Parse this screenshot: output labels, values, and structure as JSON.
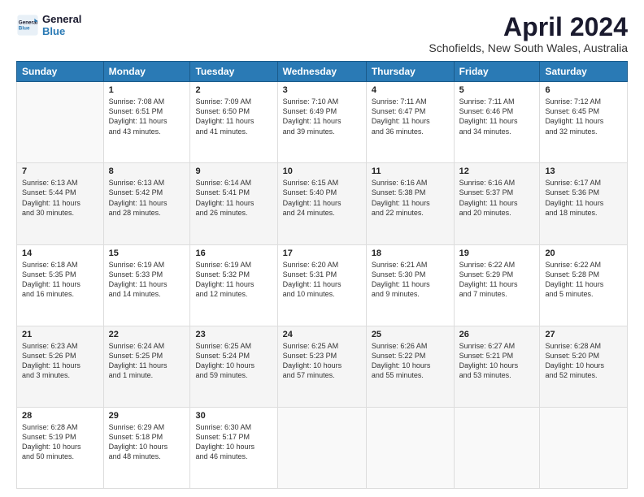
{
  "logo": {
    "line1": "General",
    "line2": "Blue"
  },
  "title": "April 2024",
  "subtitle": "Schofields, New South Wales, Australia",
  "days_of_week": [
    "Sunday",
    "Monday",
    "Tuesday",
    "Wednesday",
    "Thursday",
    "Friday",
    "Saturday"
  ],
  "weeks": [
    [
      {
        "day": "",
        "info": ""
      },
      {
        "day": "1",
        "info": "Sunrise: 7:08 AM\nSunset: 6:51 PM\nDaylight: 11 hours\nand 43 minutes."
      },
      {
        "day": "2",
        "info": "Sunrise: 7:09 AM\nSunset: 6:50 PM\nDaylight: 11 hours\nand 41 minutes."
      },
      {
        "day": "3",
        "info": "Sunrise: 7:10 AM\nSunset: 6:49 PM\nDaylight: 11 hours\nand 39 minutes."
      },
      {
        "day": "4",
        "info": "Sunrise: 7:11 AM\nSunset: 6:47 PM\nDaylight: 11 hours\nand 36 minutes."
      },
      {
        "day": "5",
        "info": "Sunrise: 7:11 AM\nSunset: 6:46 PM\nDaylight: 11 hours\nand 34 minutes."
      },
      {
        "day": "6",
        "info": "Sunrise: 7:12 AM\nSunset: 6:45 PM\nDaylight: 11 hours\nand 32 minutes."
      }
    ],
    [
      {
        "day": "7",
        "info": "Sunrise: 6:13 AM\nSunset: 5:44 PM\nDaylight: 11 hours\nand 30 minutes."
      },
      {
        "day": "8",
        "info": "Sunrise: 6:13 AM\nSunset: 5:42 PM\nDaylight: 11 hours\nand 28 minutes."
      },
      {
        "day": "9",
        "info": "Sunrise: 6:14 AM\nSunset: 5:41 PM\nDaylight: 11 hours\nand 26 minutes."
      },
      {
        "day": "10",
        "info": "Sunrise: 6:15 AM\nSunset: 5:40 PM\nDaylight: 11 hours\nand 24 minutes."
      },
      {
        "day": "11",
        "info": "Sunrise: 6:16 AM\nSunset: 5:38 PM\nDaylight: 11 hours\nand 22 minutes."
      },
      {
        "day": "12",
        "info": "Sunrise: 6:16 AM\nSunset: 5:37 PM\nDaylight: 11 hours\nand 20 minutes."
      },
      {
        "day": "13",
        "info": "Sunrise: 6:17 AM\nSunset: 5:36 PM\nDaylight: 11 hours\nand 18 minutes."
      }
    ],
    [
      {
        "day": "14",
        "info": "Sunrise: 6:18 AM\nSunset: 5:35 PM\nDaylight: 11 hours\nand 16 minutes."
      },
      {
        "day": "15",
        "info": "Sunrise: 6:19 AM\nSunset: 5:33 PM\nDaylight: 11 hours\nand 14 minutes."
      },
      {
        "day": "16",
        "info": "Sunrise: 6:19 AM\nSunset: 5:32 PM\nDaylight: 11 hours\nand 12 minutes."
      },
      {
        "day": "17",
        "info": "Sunrise: 6:20 AM\nSunset: 5:31 PM\nDaylight: 11 hours\nand 10 minutes."
      },
      {
        "day": "18",
        "info": "Sunrise: 6:21 AM\nSunset: 5:30 PM\nDaylight: 11 hours\nand 9 minutes."
      },
      {
        "day": "19",
        "info": "Sunrise: 6:22 AM\nSunset: 5:29 PM\nDaylight: 11 hours\nand 7 minutes."
      },
      {
        "day": "20",
        "info": "Sunrise: 6:22 AM\nSunset: 5:28 PM\nDaylight: 11 hours\nand 5 minutes."
      }
    ],
    [
      {
        "day": "21",
        "info": "Sunrise: 6:23 AM\nSunset: 5:26 PM\nDaylight: 11 hours\nand 3 minutes."
      },
      {
        "day": "22",
        "info": "Sunrise: 6:24 AM\nSunset: 5:25 PM\nDaylight: 11 hours\nand 1 minute."
      },
      {
        "day": "23",
        "info": "Sunrise: 6:25 AM\nSunset: 5:24 PM\nDaylight: 10 hours\nand 59 minutes."
      },
      {
        "day": "24",
        "info": "Sunrise: 6:25 AM\nSunset: 5:23 PM\nDaylight: 10 hours\nand 57 minutes."
      },
      {
        "day": "25",
        "info": "Sunrise: 6:26 AM\nSunset: 5:22 PM\nDaylight: 10 hours\nand 55 minutes."
      },
      {
        "day": "26",
        "info": "Sunrise: 6:27 AM\nSunset: 5:21 PM\nDaylight: 10 hours\nand 53 minutes."
      },
      {
        "day": "27",
        "info": "Sunrise: 6:28 AM\nSunset: 5:20 PM\nDaylight: 10 hours\nand 52 minutes."
      }
    ],
    [
      {
        "day": "28",
        "info": "Sunrise: 6:28 AM\nSunset: 5:19 PM\nDaylight: 10 hours\nand 50 minutes."
      },
      {
        "day": "29",
        "info": "Sunrise: 6:29 AM\nSunset: 5:18 PM\nDaylight: 10 hours\nand 48 minutes."
      },
      {
        "day": "30",
        "info": "Sunrise: 6:30 AM\nSunset: 5:17 PM\nDaylight: 10 hours\nand 46 minutes."
      },
      {
        "day": "",
        "info": ""
      },
      {
        "day": "",
        "info": ""
      },
      {
        "day": "",
        "info": ""
      },
      {
        "day": "",
        "info": ""
      }
    ]
  ]
}
